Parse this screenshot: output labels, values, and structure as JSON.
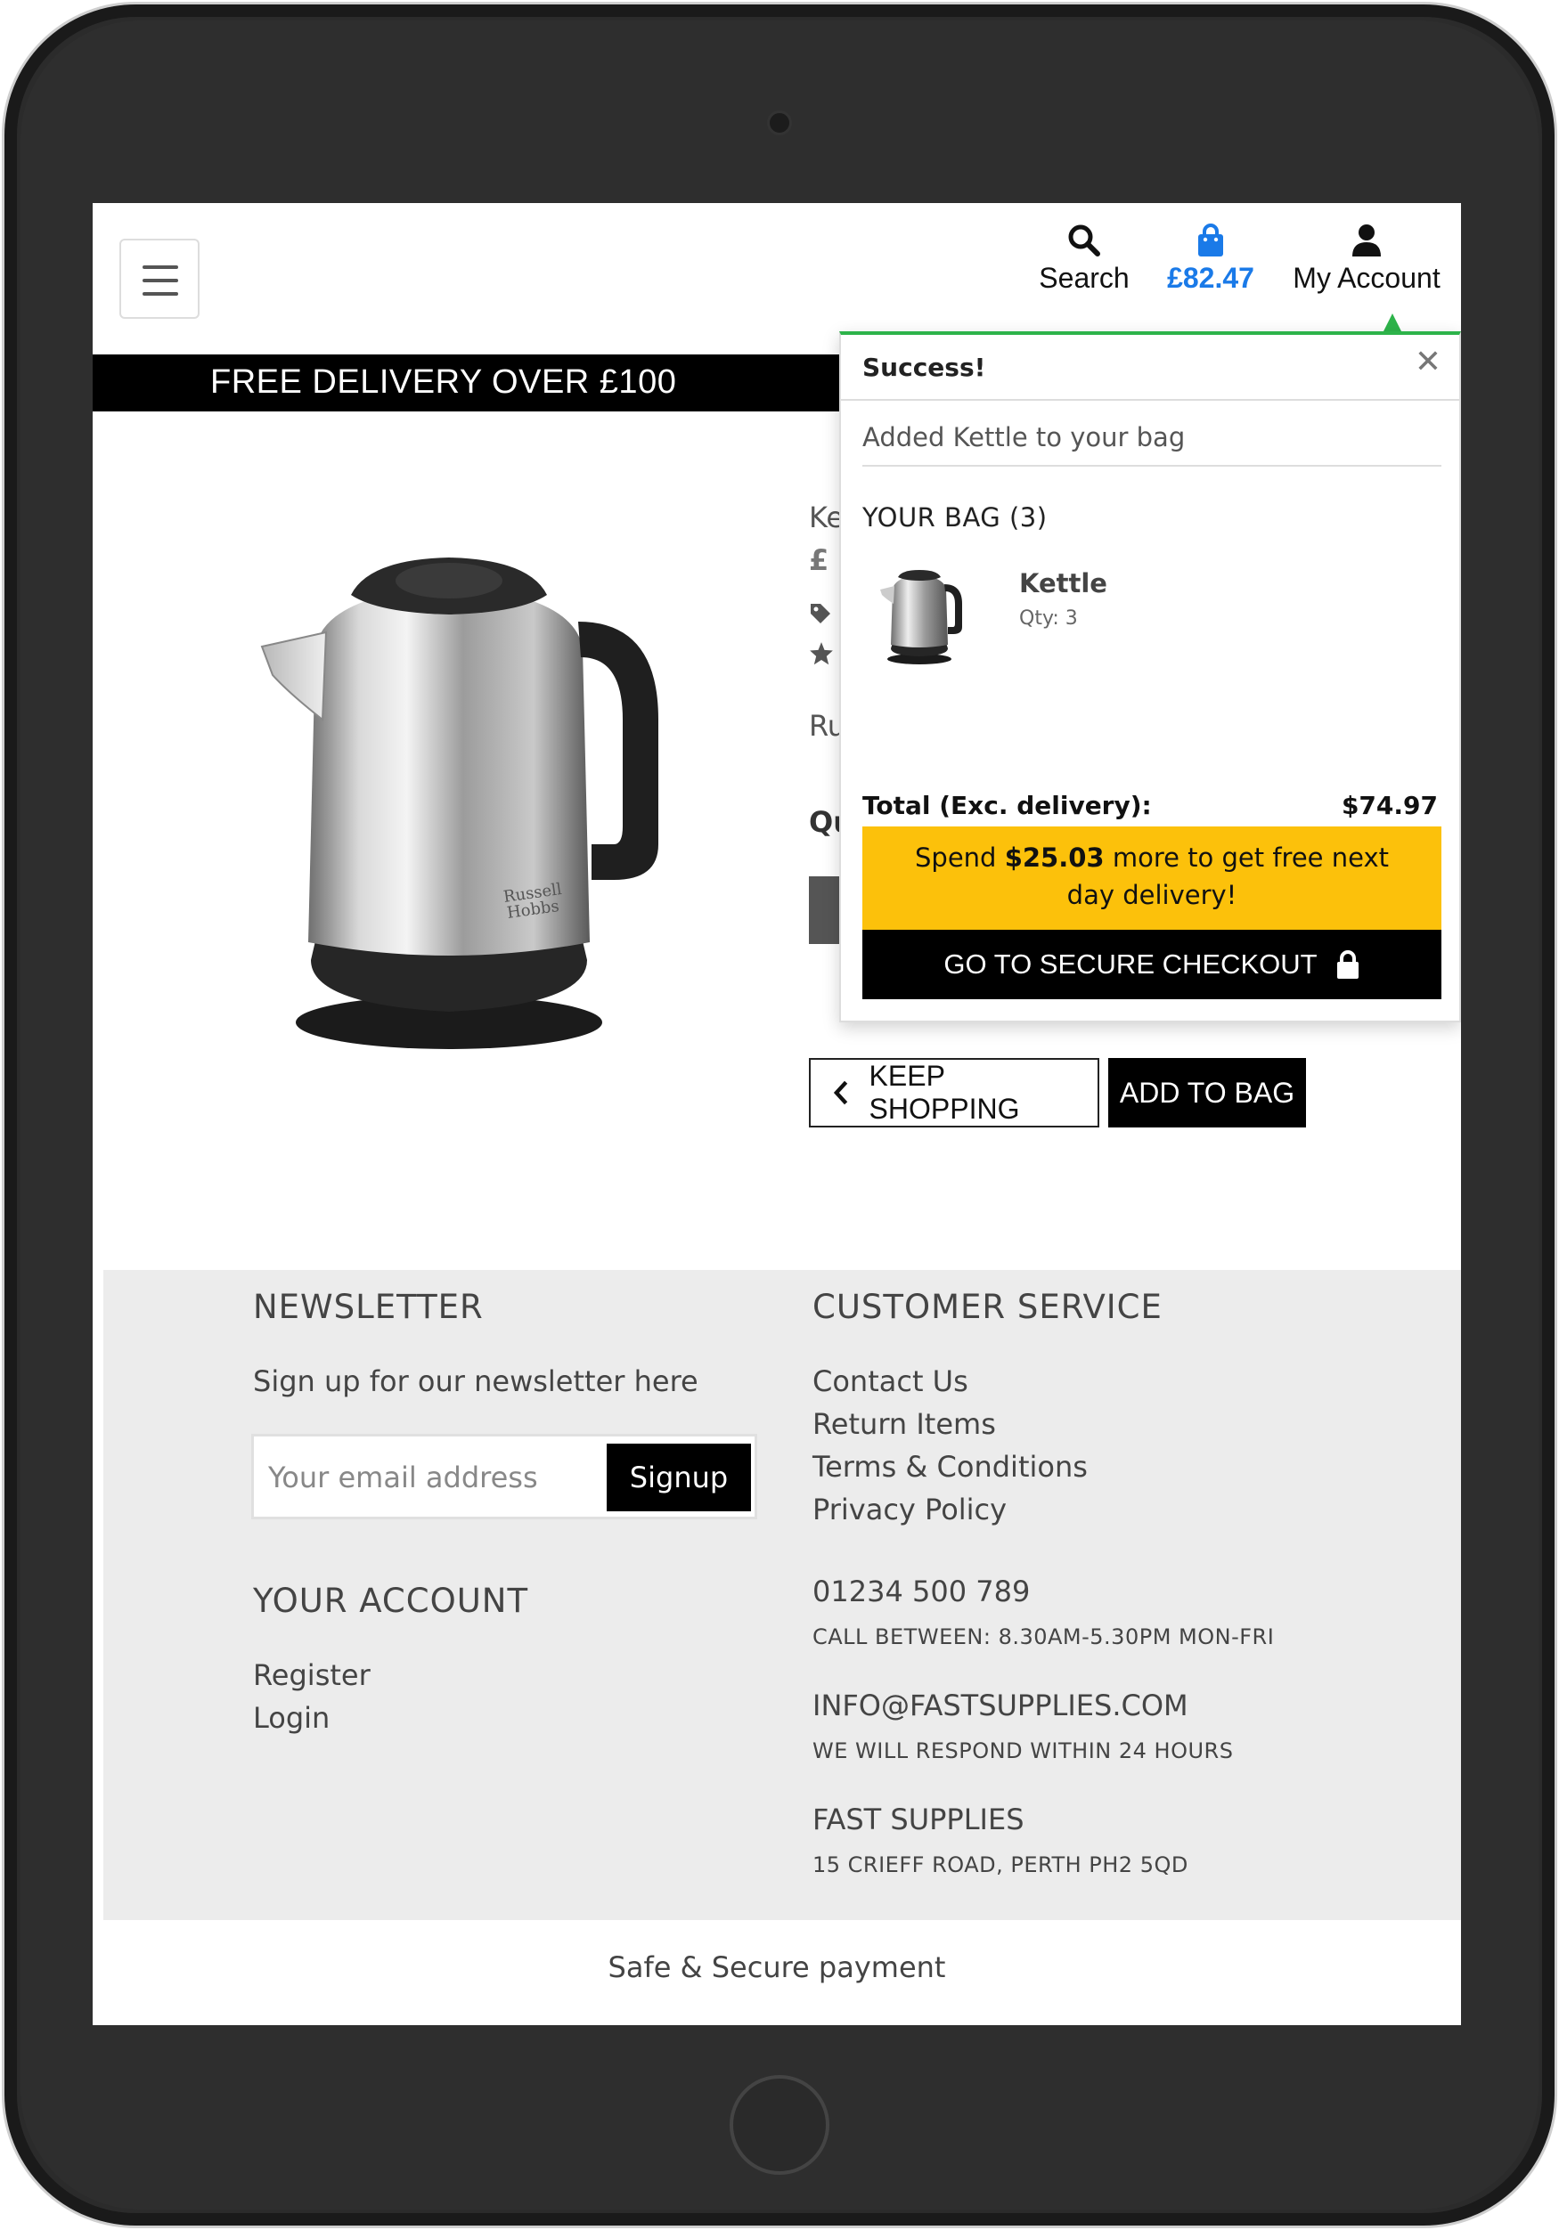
{
  "header": {
    "search_label": "Search",
    "bag_total": "£82.47",
    "account_label": "My Account",
    "promo": "FREE DELIVERY OVER £100"
  },
  "product": {
    "partial_name": "Ke",
    "partial_price": "£",
    "partial_brand": "Ru",
    "partial_qty": "Qu",
    "image_brand_line1": "Russell",
    "image_brand_line2": "Hobbs",
    "keep_shopping_label": "KEEP SHOPPING",
    "add_to_bag_label": "ADD TO BAG"
  },
  "cart_popup": {
    "title": "Success!",
    "message": "Added Kettle to your bag",
    "bag_heading": "YOUR BAG (3)",
    "items": [
      {
        "name": "Kettle",
        "qty": "Qty: 3"
      }
    ],
    "total_label": "Total (Exc. delivery):",
    "total_value": "$74.97",
    "spend_prefix": "Spend ",
    "spend_amount": "$25.03",
    "spend_suffix": " more to get free next day delivery!",
    "checkout_label": "GO TO SECURE CHECKOUT"
  },
  "footer": {
    "newsletter_heading": "NEWSLETTER",
    "newsletter_text": "Sign up for our newsletter here",
    "email_placeholder": "Your email address",
    "signup_label": "Signup",
    "account_heading": "YOUR ACCOUNT",
    "account_links": [
      "Register",
      "Login"
    ],
    "service_heading": "CUSTOMER SERVICE",
    "service_links": [
      "Contact Us",
      "Return Items",
      "Terms & Conditions",
      "Privacy Policy"
    ],
    "phone": "01234 500 789",
    "phone_hours": "CALL BETWEEN: 8.30AM-5.30PM MON-FRI",
    "email": "INFO@FASTSUPPLIES.COM",
    "email_note": "WE WILL RESPOND WITHIN 24 HOURS",
    "company": "FAST SUPPLIES",
    "address": "15 CRIEFF ROAD, PERTH PH2 5QD",
    "secure_payment": "Safe & Secure payment"
  },
  "colors": {
    "accent_blue": "#1a7ae8",
    "success_green": "#2db34a",
    "promo_yellow": "#fcc10b",
    "footer_bg": "#ececec"
  }
}
